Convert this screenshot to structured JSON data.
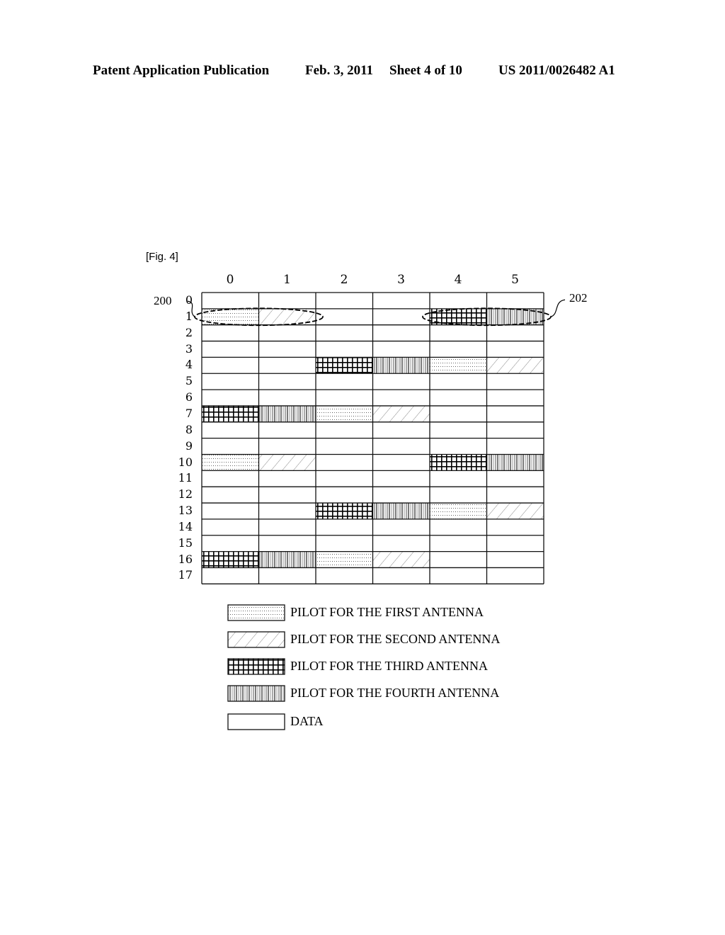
{
  "header": {
    "publication": "Patent Application Publication",
    "date": "Feb. 3, 2011",
    "sheet": "Sheet 4 of 10",
    "number": "US 2011/0026482 A1"
  },
  "figure": {
    "label": "[Fig. 4]",
    "columns": [
      "0",
      "1",
      "2",
      "3",
      "4",
      "5"
    ],
    "rows": [
      "0",
      "1",
      "2",
      "3",
      "4",
      "5",
      "6",
      "7",
      "8",
      "9",
      "10",
      "11",
      "12",
      "13",
      "14",
      "15",
      "16",
      "17"
    ],
    "cells": [
      {
        "row": 1,
        "col": 0,
        "type": "first"
      },
      {
        "row": 1,
        "col": 1,
        "type": "second"
      },
      {
        "row": 1,
        "col": 4,
        "type": "third"
      },
      {
        "row": 1,
        "col": 5,
        "type": "fourth"
      },
      {
        "row": 4,
        "col": 2,
        "type": "third"
      },
      {
        "row": 4,
        "col": 3,
        "type": "fourth"
      },
      {
        "row": 4,
        "col": 4,
        "type": "first"
      },
      {
        "row": 4,
        "col": 5,
        "type": "second"
      },
      {
        "row": 7,
        "col": 0,
        "type": "third"
      },
      {
        "row": 7,
        "col": 1,
        "type": "fourth"
      },
      {
        "row": 7,
        "col": 2,
        "type": "first"
      },
      {
        "row": 7,
        "col": 3,
        "type": "second"
      },
      {
        "row": 10,
        "col": 0,
        "type": "first"
      },
      {
        "row": 10,
        "col": 1,
        "type": "second"
      },
      {
        "row": 10,
        "col": 4,
        "type": "third"
      },
      {
        "row": 10,
        "col": 5,
        "type": "fourth"
      },
      {
        "row": 13,
        "col": 2,
        "type": "third"
      },
      {
        "row": 13,
        "col": 3,
        "type": "fourth"
      },
      {
        "row": 13,
        "col": 4,
        "type": "first"
      },
      {
        "row": 13,
        "col": 5,
        "type": "second"
      },
      {
        "row": 16,
        "col": 0,
        "type": "third"
      },
      {
        "row": 16,
        "col": 1,
        "type": "fourth"
      },
      {
        "row": 16,
        "col": 2,
        "type": "first"
      },
      {
        "row": 16,
        "col": 3,
        "type": "second"
      }
    ],
    "callouts": [
      {
        "ref": "200",
        "row": 1,
        "cols": [
          0,
          1
        ]
      },
      {
        "ref": "202",
        "row": 1,
        "cols": [
          4,
          5
        ]
      }
    ],
    "legend": [
      {
        "type": "first",
        "label": "PILOT FOR THE FIRST ANTENNA"
      },
      {
        "type": "second",
        "label": "PILOT FOR THE SECOND ANTENNA"
      },
      {
        "type": "third",
        "label": "PILOT FOR THE THIRD ANTENNA"
      },
      {
        "type": "fourth",
        "label": "PILOT FOR THE FOURTH ANTENNA"
      },
      {
        "type": "data",
        "label": "DATA"
      }
    ]
  }
}
